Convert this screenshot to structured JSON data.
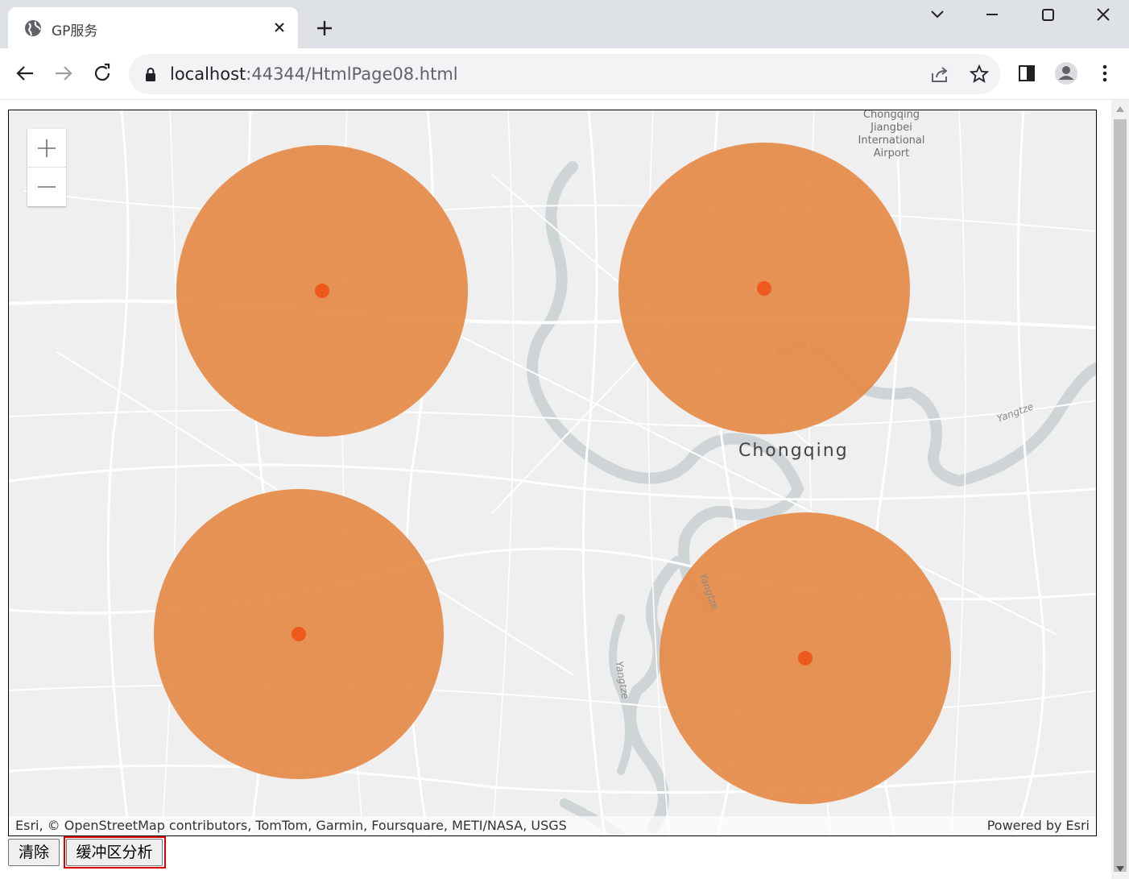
{
  "browser": {
    "tab_title": "GP服务",
    "url_host": "localhost",
    "url_rest": ":44344/HtmlPage08.html"
  },
  "map": {
    "labels": {
      "city": "Chongqing",
      "airport_line1": "Chongqing",
      "airport_line2": "Jiangbei",
      "airport_line3": "International",
      "airport_line4": "Airport",
      "river1": "Yangtze",
      "river2": "Yangtze",
      "river3": "Yangtze"
    },
    "attribution": "Esri, © OpenStreetMap contributors, TomTom, Garmin, Foursquare, METI/NASA, USGS",
    "powered_by": "Powered by Esri",
    "buffer_color": "#e58a47",
    "point_color": "#ee5a1e"
  },
  "buttons": {
    "clear": "清除",
    "buffer": "缓冲区分析"
  },
  "colors": {
    "highlight": "#e00000"
  }
}
